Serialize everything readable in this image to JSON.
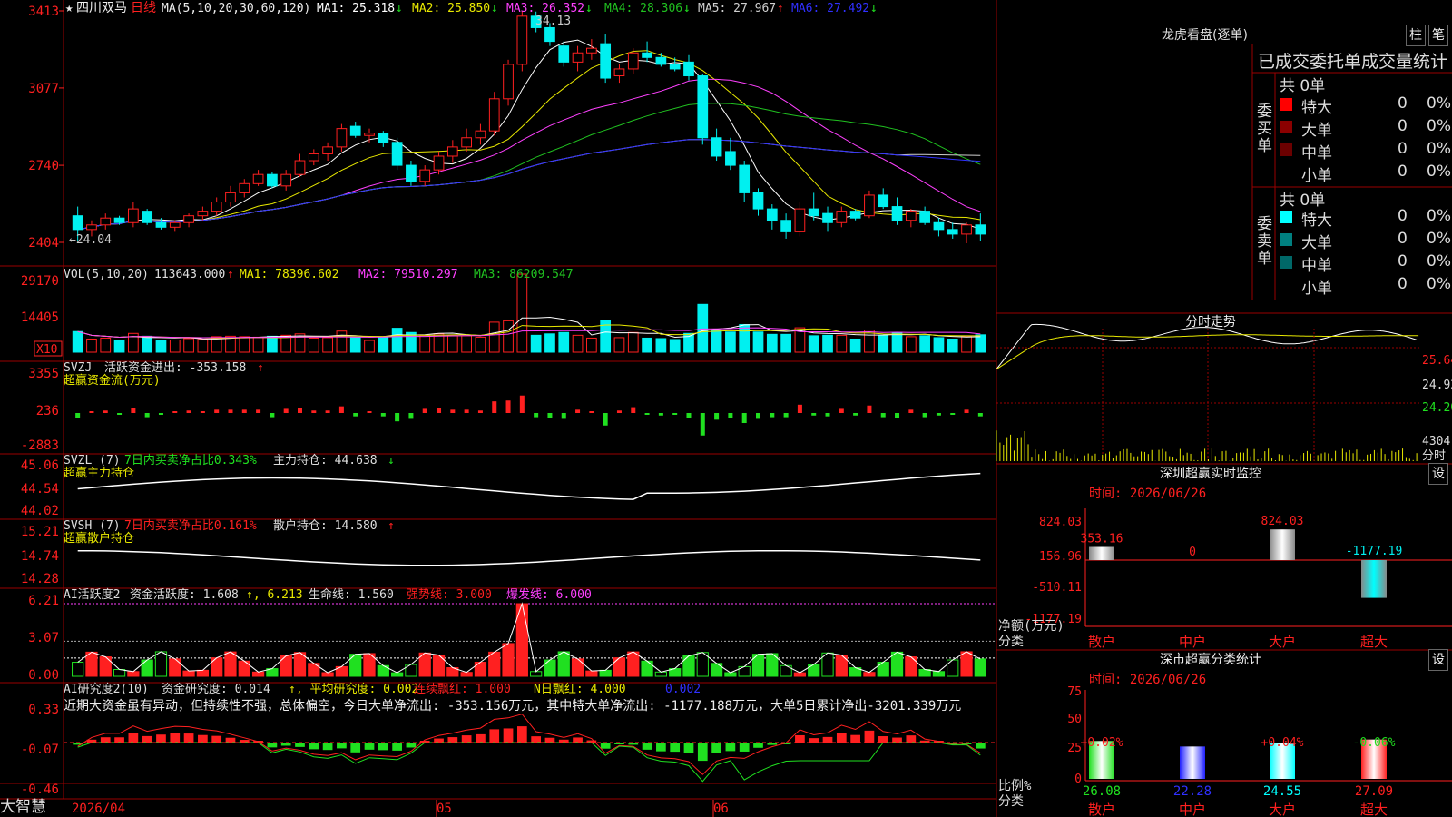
{
  "app": {
    "brand": "大智慧",
    "date_start": "2026/04",
    "axis_dates": [
      "05",
      "06"
    ]
  },
  "colors": {
    "bg": "#000000",
    "grid": "#9a0000",
    "up": "#ff2020",
    "down": "#00f0f0",
    "ma1": "#ffffff",
    "ma2": "#e8e800",
    "ma3": "#ff40ff",
    "ma4": "#20c020",
    "ma5": "#d0d0d0",
    "ma6": "#3030ff",
    "green": "#20e020"
  },
  "main": {
    "star": "★",
    "stock": "四川双马",
    "period": "日线",
    "ma_params": "MA(5,10,20,30,60,120)",
    "ma_items": [
      {
        "label": "MA1: 25.318",
        "arrow": "↓"
      },
      {
        "label": "MA2: 25.850",
        "arrow": "↓"
      },
      {
        "label": "MA3: 26.352",
        "arrow": "↓"
      },
      {
        "label": "MA4: 28.306",
        "arrow": "↓"
      },
      {
        "label": "MA5: 27.967",
        "arrow": "↑"
      },
      {
        "label": "MA6: 27.492",
        "arrow": "↓"
      }
    ],
    "yticks": [
      "3413",
      "3077",
      "2740",
      "2404"
    ],
    "hi_label": "34.13",
    "lo_label": "←24.04"
  },
  "vol": {
    "params": "VOL(5,10,20)",
    "value": "113643.000",
    "arrow": "↑",
    "ma1": "MA1: 78396.602",
    "ma2": "MA2: 79510.297",
    "ma3": "MA3: 86209.547",
    "yticks": [
      "29170",
      "14405"
    ],
    "unit": "X10"
  },
  "svzj": {
    "name": "SVZJ",
    "desc": "活跃资金进出: -353.158",
    "arrow": "↑",
    "sub": "超赢资金流(万元)",
    "yticks": [
      "3355",
      "236",
      "-2883"
    ]
  },
  "svzl": {
    "name": "SVZL (7)",
    "desc": "7日内买卖净占比0.343%",
    "desc2": "主力持仓: 44.638",
    "arrow": "↓",
    "sub": "超赢主力持仓",
    "yticks": [
      "45.06",
      "44.54",
      "44.02"
    ]
  },
  "svsh": {
    "name": "SVSH (7)",
    "desc": "7日内买卖净占比0.161%",
    "desc2": "散户持仓: 14.580",
    "arrow": "↑",
    "sub": "超赢散户持仓",
    "yticks": [
      "15.21",
      "14.74",
      "14.28"
    ]
  },
  "ai1": {
    "name": "AI活跃度2",
    "desc": "资金活跃度: 1.608",
    "v2": "6.213",
    "desc3": "生命线: 1.560",
    "desc4": "强势线: 3.000",
    "desc5": "爆发线: 6.000",
    "yticks": [
      "6.21",
      "3.07",
      "0.00"
    ]
  },
  "ai2": {
    "name": "AI研究度2(10)",
    "desc": "资金研究度: 0.014",
    "desc2": "平均研究度: 0.002",
    "desc3": "连续飘红: 1.000",
    "desc4": "N日飘红: 4.000",
    "desc5": "0.002",
    "comment": "近期大资金虽有异动，但持续性不强，总体偏空，今日大单净流出: -353.156万元，其中特大单净流出: -1177.188万元，大单5日累计净出-3201.339万元",
    "yticks": [
      "0.33",
      "-0.07",
      "-0.46"
    ]
  },
  "right": {
    "lhb_title": "龙虎看盘(逐单)",
    "btn_bar": "柱",
    "btn_tick": "笔",
    "stats_title": "已成交委托单成交量统计",
    "buy": {
      "label": "委买单",
      "total": "共 0单",
      "rows": [
        {
          "name": "特大",
          "v": "0",
          "p": "0%",
          "c": "#ff0000"
        },
        {
          "name": "大单",
          "v": "0",
          "p": "0%",
          "c": "#8b0000"
        },
        {
          "name": "中单",
          "v": "0",
          "p": "0%",
          "c": "#6b0000"
        },
        {
          "name": "小单",
          "v": "0",
          "p": "0%",
          "c": "#000000"
        }
      ]
    },
    "sell": {
      "label": "委卖单",
      "total": "共 0单",
      "rows": [
        {
          "name": "特大",
          "v": "0",
          "p": "0%",
          "c": "#00ffff"
        },
        {
          "name": "大单",
          "v": "0",
          "p": "0%",
          "c": "#008080"
        },
        {
          "name": "中单",
          "v": "0",
          "p": "0%",
          "c": "#006868"
        },
        {
          "name": "小单",
          "v": "0",
          "p": "0%",
          "c": "#000000"
        }
      ]
    },
    "fs_title": "分时走势",
    "fs_prices": [
      "25.64",
      "24.92",
      "24.20"
    ],
    "fs_vol": "4304",
    "fs_unit": "分时",
    "monitor_title": "深圳超赢实时监控",
    "settings": "设",
    "mon_time": "时间: 2026/06/26",
    "mon_yticks": [
      "824.03",
      "156.96",
      "-510.11",
      "-1177.19"
    ],
    "mon_unit": "净额(万元)",
    "mon_cat_label": "分类",
    "mon_bars": [
      {
        "name": "散户",
        "value": 353.16,
        "label": "353.16"
      },
      {
        "name": "中户",
        "value": 0,
        "label": "0"
      },
      {
        "name": "大户",
        "value": 824.03,
        "label": "824.03"
      },
      {
        "name": "超大",
        "value": -1177.19,
        "label": "-1177.19"
      }
    ],
    "class_title": "深市超赢分类统计",
    "cls_time": "时间: 2026/06/26",
    "cls_yticks": [
      "75",
      "50",
      "25",
      "0"
    ],
    "cls_unit": "比例%",
    "cls_cat_label": "分类",
    "cls_bars": [
      {
        "name": "散户",
        "value": 26.08,
        "label": "26.08",
        "chg": "+0.02%"
      },
      {
        "name": "中户",
        "value": 22.28,
        "label": "22.28",
        "chg": ""
      },
      {
        "name": "大户",
        "value": 24.55,
        "label": "24.55",
        "chg": "+0.04%"
      },
      {
        "name": "超大",
        "value": 27.09,
        "label": "27.09",
        "chg": "-0.06%"
      }
    ]
  },
  "chart_data": {
    "type": "candlestick",
    "ohlc": [
      [
        25.2,
        25.6,
        24.1,
        24.6
      ],
      [
        24.6,
        25.0,
        24.3,
        24.8
      ],
      [
        24.8,
        25.3,
        24.6,
        25.1
      ],
      [
        25.1,
        25.2,
        24.8,
        24.9
      ],
      [
        24.9,
        25.8,
        24.7,
        25.5
      ],
      [
        25.4,
        25.5,
        24.8,
        24.9
      ],
      [
        24.9,
        25.1,
        24.6,
        24.7
      ],
      [
        24.7,
        25.0,
        24.5,
        24.9
      ],
      [
        24.9,
        25.3,
        24.7,
        25.2
      ],
      [
        25.2,
        25.6,
        25.0,
        25.4
      ],
      [
        25.4,
        26.0,
        25.2,
        25.8
      ],
      [
        25.8,
        26.5,
        25.6,
        26.2
      ],
      [
        26.2,
        26.8,
        26.0,
        26.6
      ],
      [
        26.6,
        27.2,
        26.5,
        27.0
      ],
      [
        27.0,
        27.1,
        26.4,
        26.5
      ],
      [
        26.5,
        27.2,
        26.3,
        27.0
      ],
      [
        27.0,
        27.9,
        26.9,
        27.6
      ],
      [
        27.6,
        28.1,
        27.4,
        27.9
      ],
      [
        27.9,
        28.4,
        27.6,
        28.2
      ],
      [
        28.2,
        29.2,
        28.0,
        29.0
      ],
      [
        29.1,
        29.3,
        28.6,
        28.7
      ],
      [
        28.7,
        29.0,
        28.4,
        28.8
      ],
      [
        28.8,
        28.9,
        28.2,
        28.4
      ],
      [
        28.4,
        28.6,
        27.2,
        27.4
      ],
      [
        27.4,
        27.6,
        26.5,
        26.7
      ],
      [
        26.7,
        27.4,
        26.5,
        27.2
      ],
      [
        27.2,
        28.0,
        27.0,
        27.8
      ],
      [
        27.8,
        28.5,
        27.5,
        28.2
      ],
      [
        28.2,
        29.0,
        28.0,
        28.6
      ],
      [
        28.6,
        29.2,
        28.3,
        28.9
      ],
      [
        28.9,
        30.6,
        28.7,
        30.3
      ],
      [
        30.3,
        32.0,
        30.0,
        31.8
      ],
      [
        31.8,
        34.13,
        31.5,
        33.9
      ],
      [
        33.9,
        34.1,
        33.2,
        33.4
      ],
      [
        33.4,
        33.6,
        32.6,
        32.8
      ],
      [
        32.6,
        32.8,
        31.7,
        31.9
      ],
      [
        31.9,
        32.6,
        31.5,
        32.3
      ],
      [
        32.3,
        32.9,
        32.0,
        32.5
      ],
      [
        32.7,
        33.1,
        31.0,
        31.2
      ],
      [
        31.3,
        31.8,
        31.0,
        31.6
      ],
      [
        31.6,
        32.5,
        31.4,
        32.3
      ],
      [
        32.3,
        32.8,
        31.9,
        32.1
      ],
      [
        32.1,
        32.3,
        31.7,
        31.8
      ],
      [
        31.8,
        32.1,
        31.5,
        31.6
      ],
      [
        31.9,
        32.2,
        31.1,
        31.3
      ],
      [
        31.3,
        31.4,
        28.3,
        28.6
      ],
      [
        28.6,
        29.0,
        27.6,
        27.8
      ],
      [
        28.0,
        28.6,
        27.2,
        27.4
      ],
      [
        27.4,
        27.6,
        25.8,
        26.2
      ],
      [
        26.2,
        26.4,
        25.2,
        25.5
      ],
      [
        25.5,
        25.7,
        24.6,
        25.0
      ],
      [
        25.0,
        25.3,
        24.2,
        24.5
      ],
      [
        24.5,
        25.8,
        24.3,
        25.5
      ],
      [
        25.5,
        26.2,
        25.0,
        25.2
      ],
      [
        25.3,
        25.6,
        24.5,
        24.9
      ],
      [
        24.9,
        25.6,
        24.7,
        25.4
      ],
      [
        25.4,
        25.5,
        25.0,
        25.1
      ],
      [
        25.2,
        26.3,
        25.1,
        26.1
      ],
      [
        26.1,
        26.4,
        25.5,
        25.6
      ],
      [
        25.6,
        26.0,
        24.8,
        25.0
      ],
      [
        25.0,
        25.5,
        24.7,
        25.4
      ],
      [
        25.4,
        25.6,
        24.8,
        24.9
      ],
      [
        24.9,
        25.1,
        24.3,
        24.6
      ],
      [
        24.6,
        24.9,
        24.2,
        24.4
      ],
      [
        24.4,
        24.9,
        24.0,
        24.8
      ],
      [
        24.8,
        25.3,
        24.1,
        24.4
      ]
    ]
  }
}
